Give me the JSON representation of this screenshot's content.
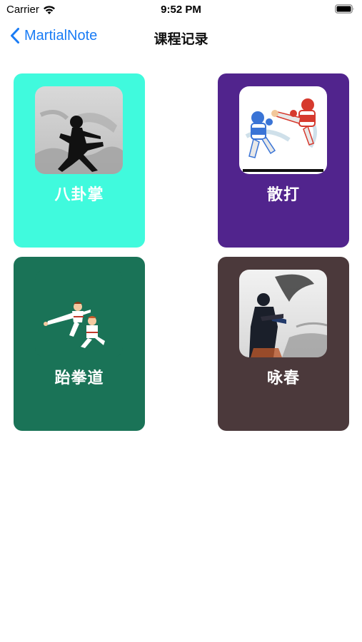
{
  "status_bar": {
    "carrier": "Carrier",
    "time": "9:52 PM"
  },
  "nav": {
    "back_label": "MartialNote",
    "title": "课程记录",
    "accent_color": "#1a7cf5"
  },
  "courses": [
    {
      "label": "八卦掌",
      "color": "#40fadd",
      "image": "martial-artist-silhouette-image"
    },
    {
      "label": "散打",
      "color": "#51248d",
      "image": "sanda-fighters-image"
    },
    {
      "label": "跆拳道",
      "color": "#1a7357",
      "image": "taekwondo-kick-image"
    },
    {
      "label": "咏春",
      "color": "#4b393b",
      "image": "wing-chun-silhouette-image"
    }
  ]
}
